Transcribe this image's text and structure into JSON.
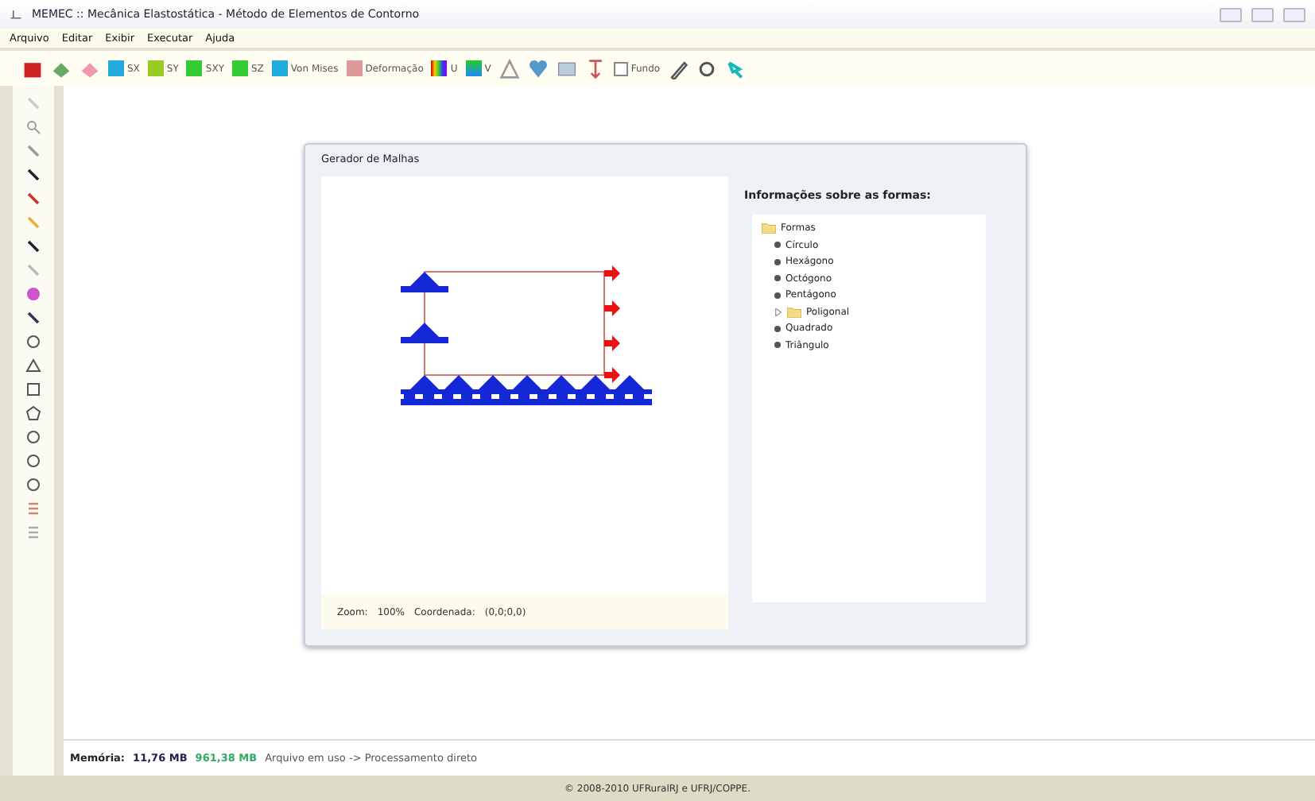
{
  "window": {
    "title": "MEMEC :: Mecânica Elastostática - Método de Elementos de Contorno"
  },
  "menu": [
    "Arquivo",
    "Editar",
    "Exibir",
    "Executar",
    "Ajuda"
  ],
  "toolbar": {
    "result_buttons": [
      {
        "label": "SX"
      },
      {
        "label": "SY"
      },
      {
        "label": "SXY"
      },
      {
        "label": "SZ"
      },
      {
        "label": "Von Mises"
      },
      {
        "label": "Deformação"
      },
      {
        "label": "U"
      },
      {
        "label": "V"
      }
    ],
    "background_checkbox": {
      "label": "Fundo",
      "checked": false
    }
  },
  "dialog": {
    "title": "Gerador de Malhas",
    "status": {
      "zoom_label": "Zoom:",
      "zoom": "100%",
      "coord_label": "Coordenada:",
      "coord": "(0,0;0,0)"
    },
    "info_heading": "Informações sobre as formas:",
    "tree": [
      {
        "label": "Formas",
        "kind": "folder",
        "children": [
          {
            "label": "Círculo",
            "kind": "leaf"
          },
          {
            "label": "Hexágono",
            "kind": "leaf"
          },
          {
            "label": "Octógono",
            "kind": "leaf"
          },
          {
            "label": "Pentágono",
            "kind": "leaf"
          },
          {
            "label": "Poligonal",
            "kind": "folder",
            "expanded": false
          },
          {
            "label": "Quadrado",
            "kind": "leaf"
          },
          {
            "label": "Triângulo",
            "kind": "leaf"
          }
        ]
      }
    ]
  },
  "status_bar": {
    "memory_label": "Memória:",
    "memory_used": "11,76 MB",
    "memory_free": "961,38 MB",
    "message": "Arquivo em uso -> Processamento direto"
  },
  "footer": "© 2008-2010  UFRuralRJ e UFRJ/COPPE."
}
